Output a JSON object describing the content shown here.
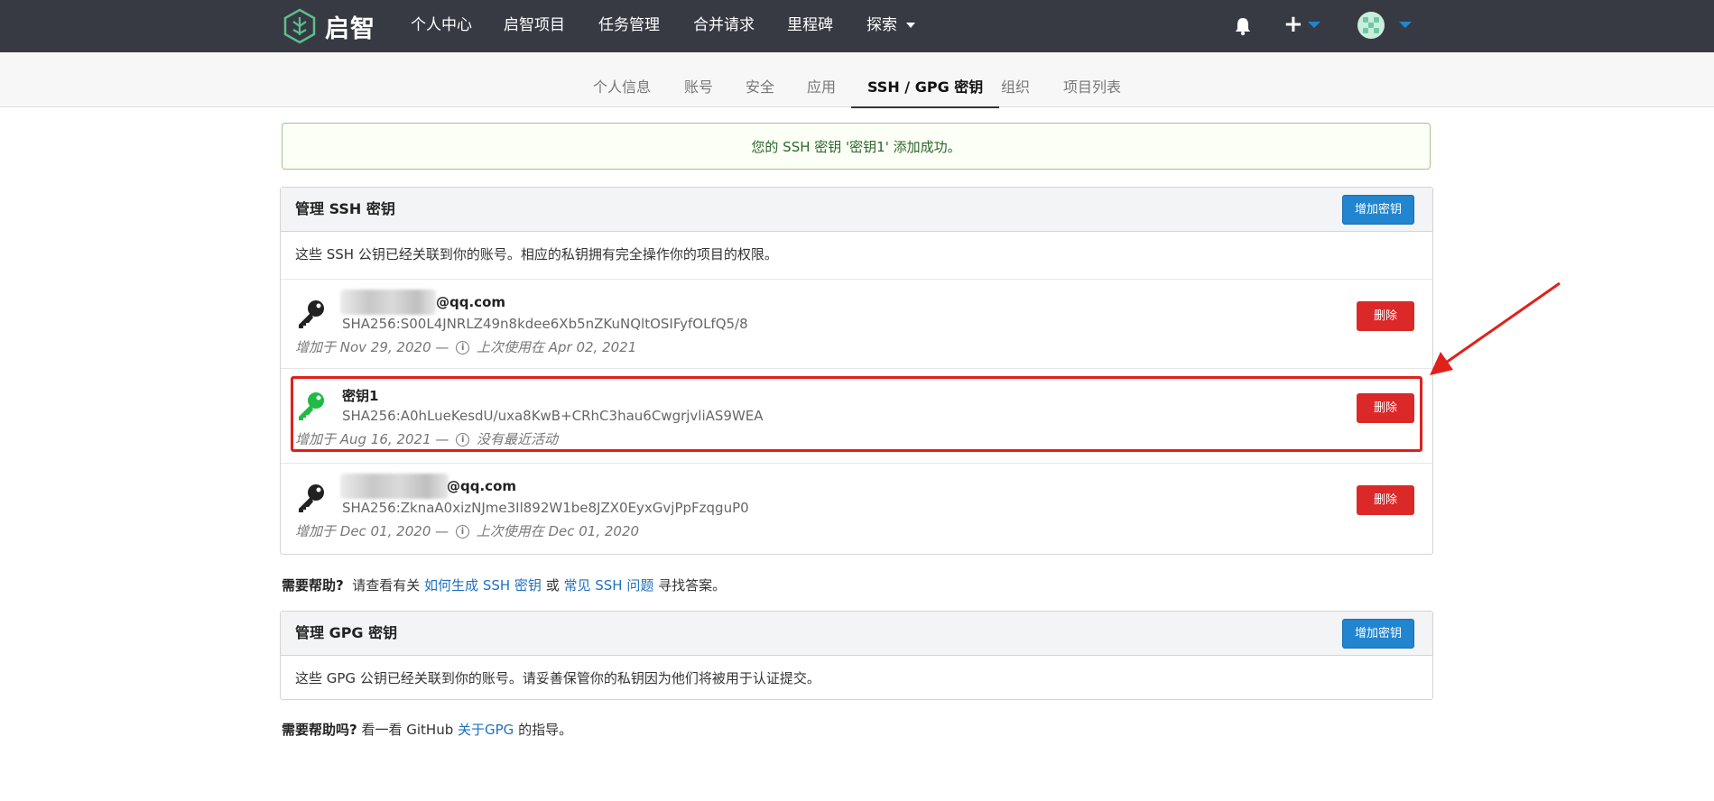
{
  "navbar": {
    "logo_text": "启智",
    "items": [
      {
        "label": "个人中心"
      },
      {
        "label": "启智项目"
      },
      {
        "label": "任务管理"
      },
      {
        "label": "合并请求"
      },
      {
        "label": "里程碑"
      },
      {
        "label": "探索"
      }
    ],
    "plus_label": "+",
    "accent": "#2185d0",
    "bg": "#373a43"
  },
  "tabs": [
    {
      "label": "个人信息"
    },
    {
      "label": "账号"
    },
    {
      "label": "安全"
    },
    {
      "label": "应用"
    },
    {
      "label": "SSH / GPG 密钥",
      "active": true
    },
    {
      "label": "组织"
    },
    {
      "label": "项目列表"
    }
  ],
  "success_message": "您的 SSH 密钥 '密钥1' 添加成功。",
  "ssh": {
    "title": "管理 SSH 密钥",
    "add_button": "增加密钥",
    "description": "这些 SSH 公钥已经关联到你的账号。相应的私钥拥有完全操作你的项目的权限。",
    "keys": [
      {
        "name": "@qq.com",
        "fingerprint": "SHA256:S00L4JNRLZ49n8kdee6Xb5nZKuNQltOSIFyfOLfQ5/8",
        "added": "增加于 Nov 29, 2020 —",
        "last_used": "上次使用在 Apr 02, 2021",
        "delete_button": "删除",
        "icon_color": "#222222"
      },
      {
        "name": "密钥1",
        "fingerprint": "SHA256:A0hLueKesdU/uxa8KwB+CRhC3hau6CwgrjvliAS9WEA",
        "added": "增加于 Aug 16, 2021 —",
        "last_used": "没有最近活动",
        "delete_button": "删除",
        "icon_color": "#21ba45"
      },
      {
        "name": "@qq.com",
        "fingerprint": "SHA256:ZknaA0xizNJme3Il892W1be8JZX0EyxGvjPpFzqguP0",
        "added": "增加于 Dec 01, 2020 —",
        "last_used": "上次使用在 Dec 01, 2020",
        "delete_button": "删除",
        "icon_color": "#222222"
      }
    ]
  },
  "ssh_help": {
    "lead": "需要帮助?",
    "text1": "请查看有关",
    "link1": "如何生成 SSH 密钥",
    "text2": "或",
    "link2": "常见 SSH 问题",
    "text3": "寻找答案。"
  },
  "gpg": {
    "title": "管理 GPG 密钥",
    "add_button": "增加密钥",
    "description": "这些 GPG 公钥已经关联到你的账号。请妥善保管你的私钥因为他们将被用于认证提交。"
  },
  "gpg_help": {
    "lead": "需要帮助吗?",
    "text1": "看一看 GitHub",
    "link1": "关于GPG",
    "text2": "的指导。"
  },
  "annotation_color": "#e0201b"
}
